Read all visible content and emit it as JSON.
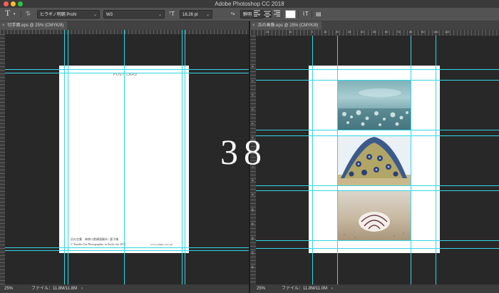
{
  "app": {
    "title": "Adobe Photoshop CC 2018"
  },
  "options_bar": {
    "tool_icon": "T",
    "orientation_icon": "vertical-type-icon",
    "font_family": "ヒラギノ明朝 ProN",
    "font_style": "W3",
    "font_size": "16.26 pt",
    "size_icon": "font-size-icon",
    "aa_label": "ªa",
    "anti_alias": "鮮明",
    "swatch_color": "#ffffff"
  },
  "left_doc": {
    "tab": "切手面.eps @ 25% (CMYK/8)",
    "close": "×",
    "postcard_label": "POST CARD",
    "caption_line1": "浜の言葉　神奈川県横須賀市 / 夏子様",
    "caption_line2": "© Yumiko Ota Photographer, in Zushi city 2018",
    "caption_url": "www.yumiko-ota.com",
    "zoom": "25%",
    "file_info": "ファイル：11.8M/11.8M",
    "arrow": "›"
  },
  "right_doc": {
    "tab": "浜の画像.eps @ 25% (CMYK/8)",
    "close": "×",
    "ruler_numbers": [
      "20",
      "10",
      "0",
      "10",
      "20",
      "30",
      "40",
      "50",
      "60",
      "70",
      "80",
      "90",
      "100",
      "110"
    ],
    "vruler_numbers": [
      "0",
      "1",
      "2",
      "3",
      "4",
      "5",
      "6",
      "7",
      "8",
      "9",
      "10",
      "11",
      "12",
      "13",
      "14"
    ],
    "zoom": "25%",
    "file_info": "ファイル：11.8M/11.0M",
    "arrow": "›"
  },
  "overlay": {
    "number": "38"
  },
  "colors": {
    "guide": "#33d6e6",
    "canvas_bg": "#282828",
    "panel": "#535353"
  }
}
